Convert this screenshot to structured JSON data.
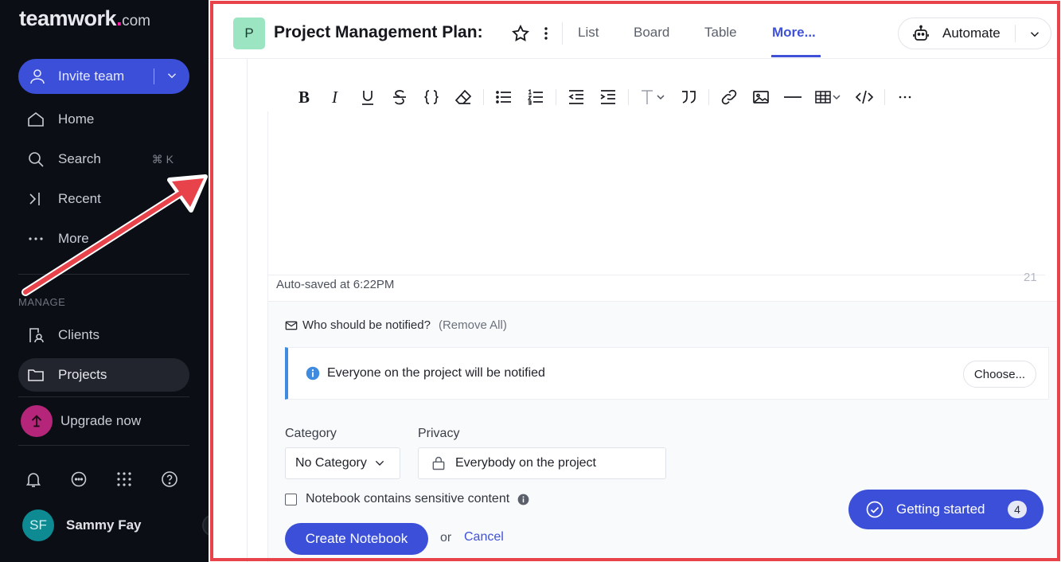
{
  "brand": {
    "name": "teamwork",
    "dot": ".",
    "suffix": "com",
    "accent": "#ff22a4"
  },
  "sidebar": {
    "invite_label": "Invite team",
    "nav": [
      {
        "label": "Home",
        "icon": "home-icon"
      },
      {
        "label": "Search",
        "icon": "search-icon",
        "shortcut": "⌘ K"
      },
      {
        "label": "Recent",
        "icon": "recent-icon"
      },
      {
        "label": "More",
        "icon": "more-icon"
      }
    ],
    "section_label": "MANAGE",
    "manage": [
      {
        "label": "Clients",
        "icon": "clients-icon"
      },
      {
        "label": "Projects",
        "icon": "folder-icon",
        "active": true
      }
    ],
    "upgrade_label": "Upgrade now",
    "bottom_icons": [
      "bell-icon",
      "chat-icon",
      "apps-grid-icon",
      "help-icon"
    ],
    "user": {
      "initials": "SF",
      "name": "Sammy Fay"
    }
  },
  "header": {
    "project_initial": "P",
    "project_title": "Project Management Plan:",
    "tabs": [
      {
        "label": "List",
        "active": false
      },
      {
        "label": "Board",
        "active": false
      },
      {
        "label": "Table",
        "active": false
      },
      {
        "label": "More...",
        "active": true
      }
    ],
    "automate_label": "Automate"
  },
  "toolbar": {
    "buttons": [
      "bold-icon",
      "italic-icon",
      "underline-icon",
      "strikethrough-icon",
      "code-braces-icon",
      "eraser-icon",
      "bullet-list-icon",
      "numbered-list-icon",
      "outdent-icon",
      "indent-icon",
      "text-style-icon",
      "quote-icon",
      "link-icon",
      "image-icon",
      "horizontal-rule-icon",
      "table-icon",
      "code-view-icon",
      "more-options-icon"
    ]
  },
  "editor": {
    "autosave_text": "Auto-saved at 6:22PM",
    "char_count": "21"
  },
  "notify": {
    "question": "Who should be notified?",
    "remove_all": "(Remove All)",
    "notice_text": "Everyone on the project will be notified",
    "choose_label": "Choose..."
  },
  "form": {
    "category_label": "Category",
    "category_value": "No Category",
    "privacy_label": "Privacy",
    "privacy_value": "Everybody on the project",
    "sensitive_label": "Notebook contains sensitive content",
    "create_label": "Create Notebook",
    "or_text": "or",
    "cancel_label": "Cancel"
  },
  "getting_started": {
    "label": "Getting started",
    "count": "4"
  },
  "colors": {
    "primary": "#3b4fd8",
    "sidebar_bg": "#0b0e14",
    "annotation": "#e8424a"
  }
}
